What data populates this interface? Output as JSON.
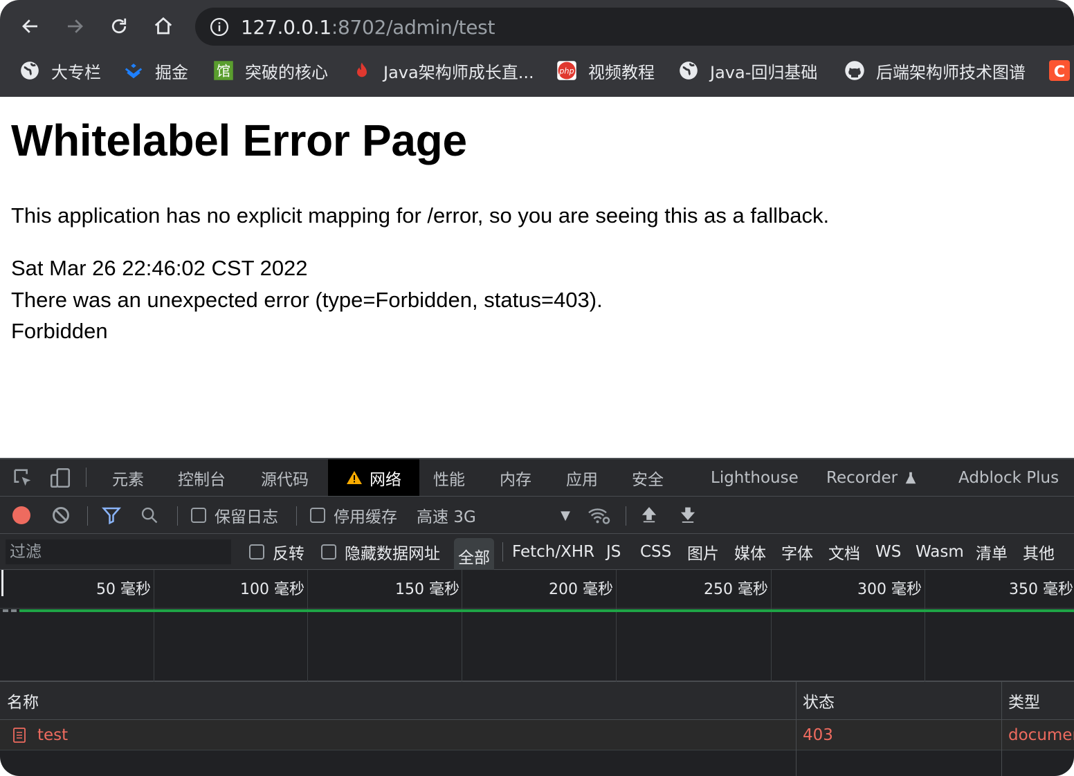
{
  "browser": {
    "url_host": "127.0.0.1",
    "url_rest": ":8702/admin/test",
    "bookmarks": [
      {
        "label": "大专栏",
        "icon": "globe-icon"
      },
      {
        "label": "掘金",
        "icon": "juejin-icon"
      },
      {
        "label": "突破的核心",
        "icon": "green-logo-icon"
      },
      {
        "label": "Java架构师成长直...",
        "icon": "flame-icon"
      },
      {
        "label": "视频教程",
        "icon": "php-icon"
      },
      {
        "label": "Java-回归基础",
        "icon": "globe-icon"
      },
      {
        "label": "后端架构师技术图谱",
        "icon": "github-icon"
      }
    ],
    "colors": {
      "chrome": "#35363a",
      "omnibox": "#202124"
    }
  },
  "page": {
    "title": "Whitelabel Error Page",
    "message": "This application has no explicit mapping for /error, so you are seeing this as a fallback.",
    "timestamp": "Sat Mar 26 22:46:02 CST 2022",
    "error_line": "There was an unexpected error (type=Forbidden, status=403).",
    "reason": "Forbidden"
  },
  "devtools": {
    "tabs": [
      "元素",
      "控制台",
      "源代码",
      "网络",
      "性能",
      "内存",
      "应用",
      "安全",
      "Lighthouse",
      "Recorder",
      "Adblock Plus"
    ],
    "active_tab": "网络",
    "toolbar": {
      "preserve_log": "保留日志",
      "disable_cache": "停用缓存",
      "throttling": "高速 3G"
    },
    "filter": {
      "placeholder": "过滤",
      "invert": "反转",
      "hide_data_urls": "隐藏数据网址",
      "types": [
        "全部",
        "Fetch/XHR",
        "JS",
        "CSS",
        "图片",
        "媒体",
        "字体",
        "文档",
        "WS",
        "Wasm",
        "清单",
        "其他"
      ],
      "active_type": "全部"
    },
    "timeline_ticks": [
      "50 毫秒",
      "100 毫秒",
      "150 毫秒",
      "200 毫秒",
      "250 毫秒",
      "300 毫秒",
      "350 毫秒"
    ],
    "columns": [
      "名称",
      "状态",
      "类型"
    ],
    "rows": [
      {
        "name": "test",
        "status": "403",
        "type": "document"
      }
    ],
    "colors": {
      "error_text": "#ee6b5f",
      "record": "#ee6b5f",
      "waterfall": "#1ea446",
      "filter_icon": "#8ab4f8"
    }
  }
}
